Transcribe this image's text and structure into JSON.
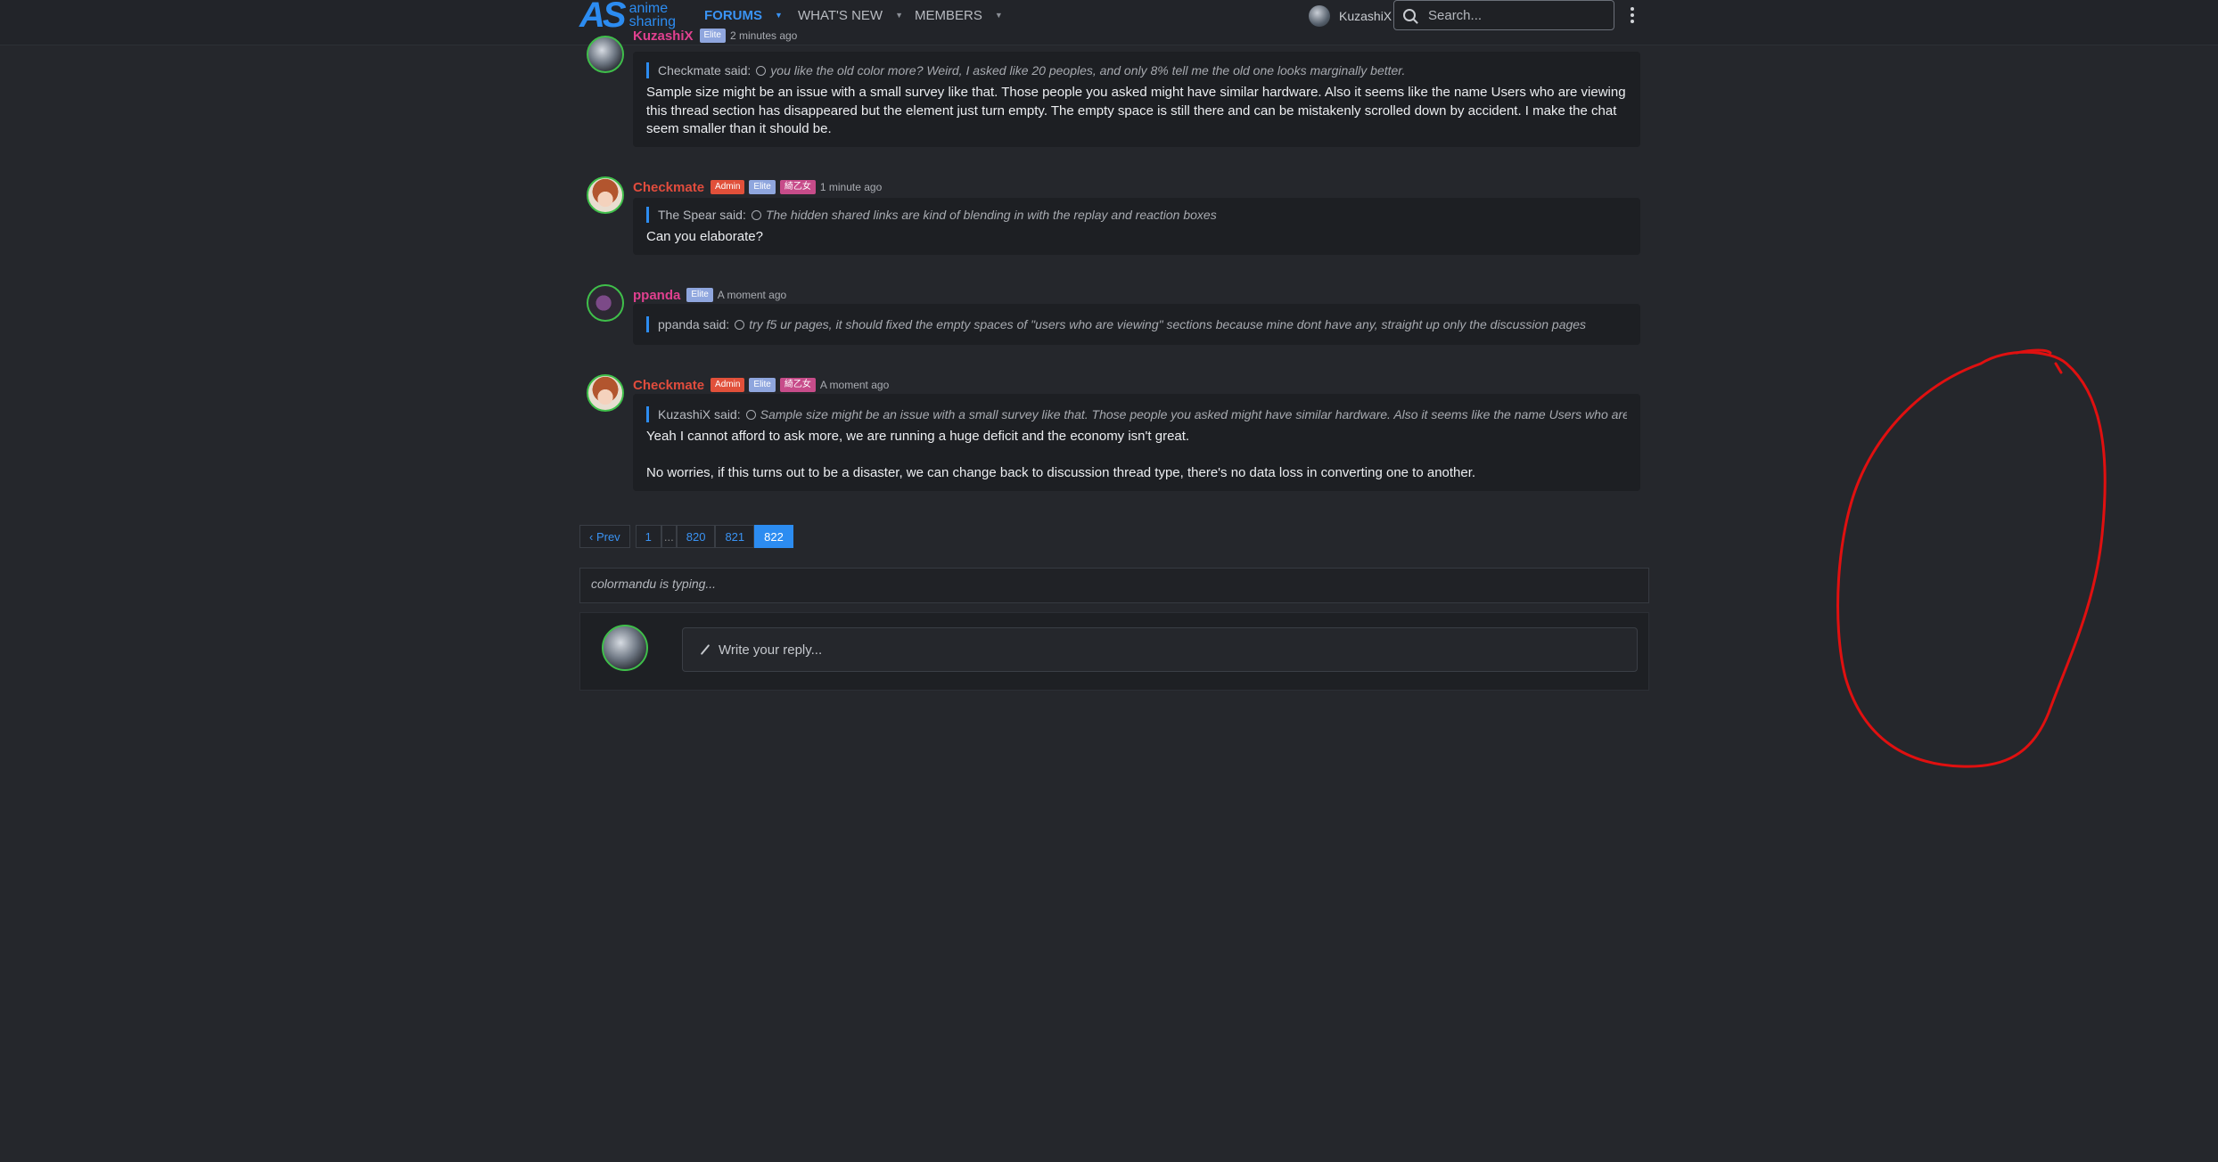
{
  "nav": {
    "logo_mark": "AS",
    "logo_line1": "anime",
    "logo_line2": "sharing",
    "forums": "FORUMS",
    "whats_new": "WHAT'S NEW",
    "members": "MEMBERS",
    "username": "KuzashiX",
    "search_placeholder": "Search..."
  },
  "messages": [
    {
      "user": "KuzashiX",
      "badges": [
        "Elite"
      ],
      "time": "2 minutes ago",
      "quote_by": "Checkmate said:",
      "quote": "you like the old color more? Weird, I asked like 20 peoples, and only 8% tell me the old one looks marginally better.",
      "paragraphs": [
        "Sample size might be an issue with a small survey like that. Those people you asked might have similar hardware. Also it seems like the name Users who are viewing this thread section has disappeared but the element just turn empty. The empty space is still there and can be mistakenly scrolled down by accident. I make the chat seem smaller than it should be."
      ]
    },
    {
      "user": "Checkmate",
      "badges": [
        "Admin",
        "Elite",
        "綺乙女"
      ],
      "time": "1 minute ago",
      "quote_by": "The Spear said:",
      "quote": "The hidden shared links are kind of blending in with the replay and reaction boxes",
      "paragraphs": [
        "Can you elaborate?"
      ]
    },
    {
      "user": "ppanda",
      "badges": [
        "Elite"
      ],
      "time": "A moment ago",
      "quote_by": "ppanda said:",
      "quote": "try f5 ur pages, it should fixed the empty spaces of \"users who are viewing\" sections because mine dont have any, straight up only the discussion pages",
      "paragraphs": []
    },
    {
      "user": "Checkmate",
      "badges": [
        "Admin",
        "Elite",
        "綺乙女"
      ],
      "time": "A moment ago",
      "quote_by": "KuzashiX said:",
      "quote": "Sample size might be an issue with a small survey like that. Those people you asked might have similar hardware. Also it seems like the name Users who are...",
      "paragraphs": [
        "Yeah I cannot afford to ask more, we are running a huge deficit and the economy isn't great.",
        "No worries, if this turns out to be a disaster, we can change back to discussion thread type, there's no data loss in converting one to another."
      ]
    }
  ],
  "pagination": {
    "prev": "‹ Prev",
    "first": "1",
    "dots": "...",
    "p820": "820",
    "p821": "821",
    "current": "822"
  },
  "typing_indicator": "colormandu is typing...",
  "reply_placeholder": "Write your reply...",
  "colors": {
    "accent": "#2c8cf1",
    "admin_badge": "#e1503a",
    "elite_badge": "#8fa6de",
    "annotation": "#e01010"
  }
}
